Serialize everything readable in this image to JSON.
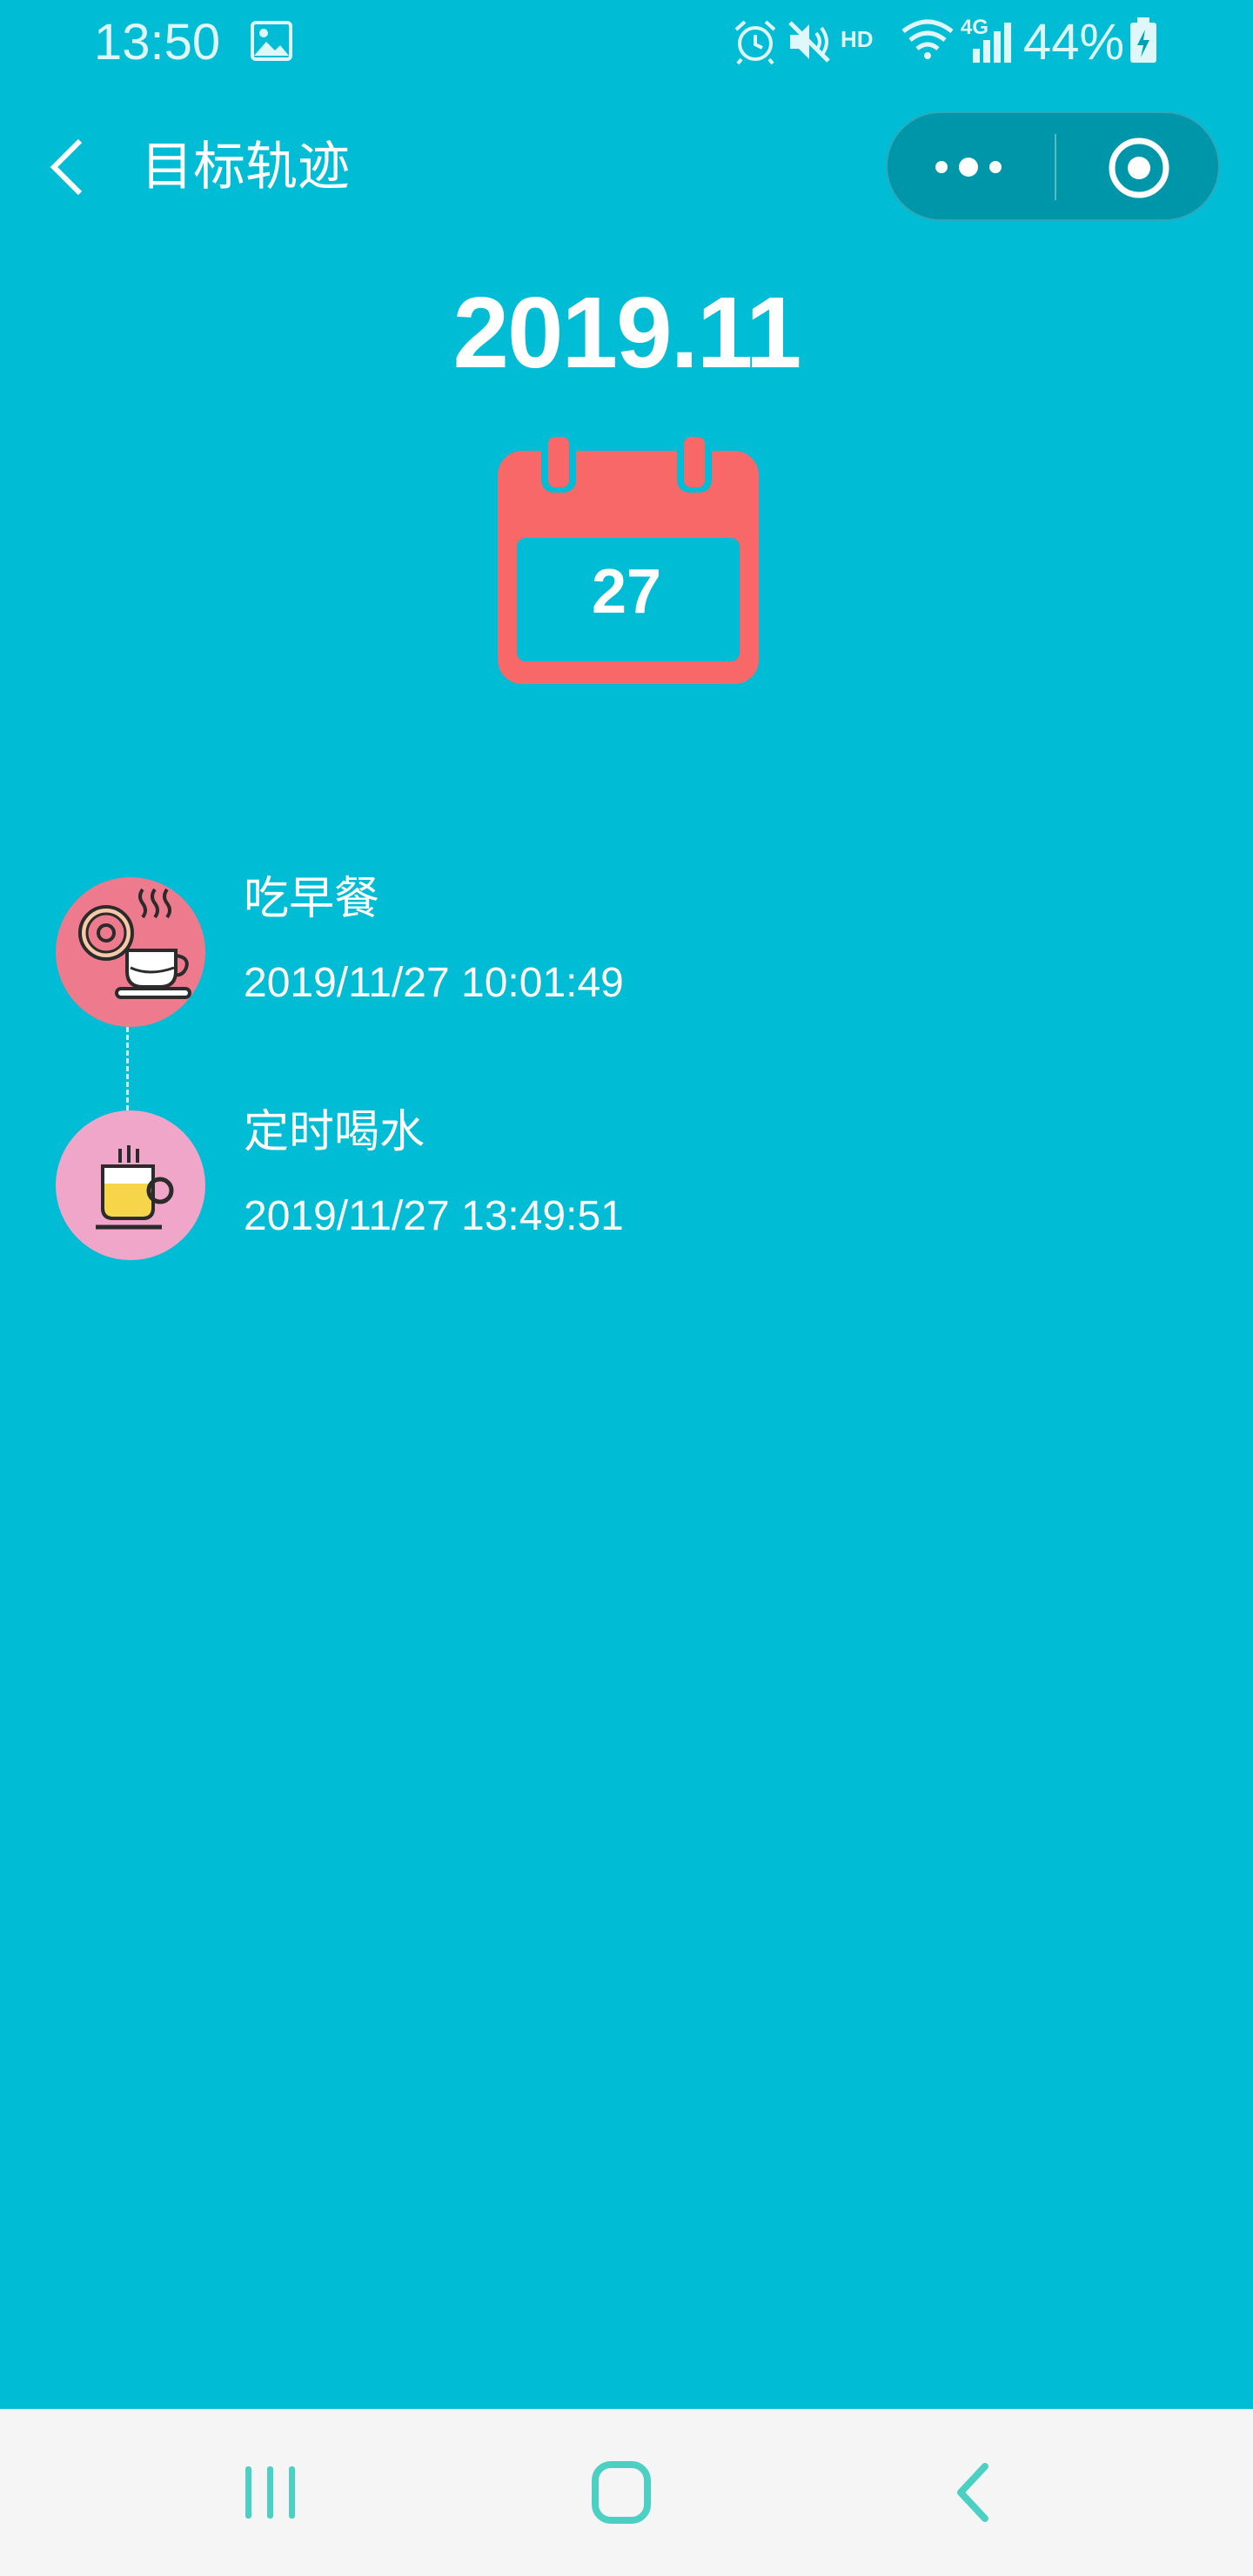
{
  "status_bar": {
    "time": "13:50",
    "network": "HD",
    "signal": "4G",
    "battery": "44%",
    "icons": [
      "gallery-icon",
      "alarm-icon",
      "mute-icon",
      "wifi-icon",
      "signal-icon",
      "battery-charging-icon"
    ]
  },
  "nav": {
    "title": "目标轨迹",
    "back_icon": "chevron-left-icon",
    "menu_icon": "more-dots-icon",
    "close_icon": "target-circle-icon"
  },
  "header": {
    "month": "2019.11",
    "day": "27"
  },
  "timeline": {
    "items": [
      {
        "title": "吃早餐",
        "time": "2019/11/27 10:01:49",
        "icon": "donut-coffee-icon",
        "color": "#EE7A8E"
      },
      {
        "title": "定时喝水",
        "time": "2019/11/27 13:49:51",
        "icon": "cup-icon",
        "color": "#F0A6C8"
      }
    ]
  },
  "system_nav": {
    "icons": [
      "recents-icon",
      "home-icon",
      "back-icon"
    ],
    "accent": "#4DD0C4"
  },
  "colors": {
    "background": "#00BCD4",
    "calendar": "#F96868"
  }
}
